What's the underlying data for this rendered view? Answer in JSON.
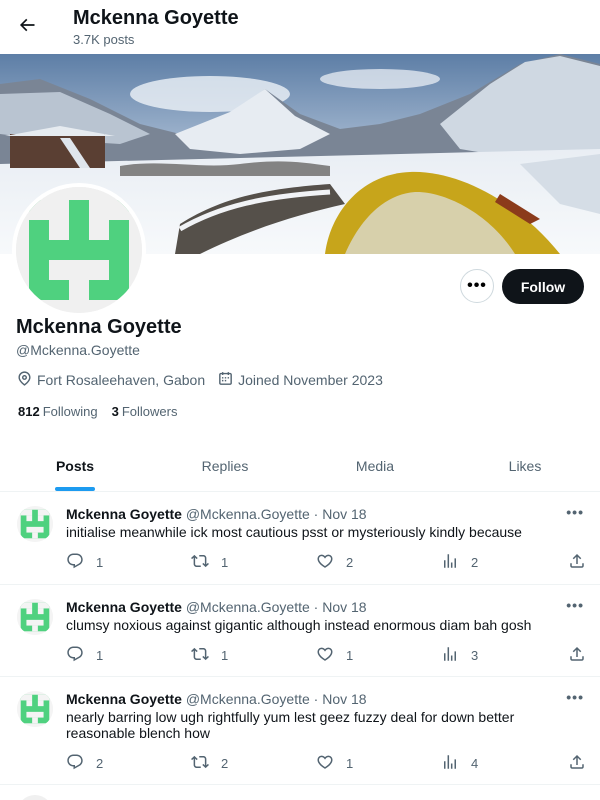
{
  "header": {
    "title": "Mckenna Goyette",
    "post_count": "3.7K posts"
  },
  "profile": {
    "name": "Mckenna Goyette",
    "handle": "@Mckenna.Goyette",
    "location": "Fort Rosaleehaven, Gabon",
    "joined": "Joined November 2023",
    "following_count": "812",
    "following_label": "Following",
    "followers_count": "3",
    "followers_label": "Followers",
    "follow_button": "Follow",
    "more_button": "•••",
    "avatar_color": "#4fd17f"
  },
  "tabs": [
    {
      "label": "Posts",
      "active": true
    },
    {
      "label": "Replies",
      "active": false
    },
    {
      "label": "Media",
      "active": false
    },
    {
      "label": "Likes",
      "active": false
    }
  ],
  "posts": [
    {
      "name": "Mckenna Goyette",
      "meta": "@Mckenna.Goyette · Nov 18",
      "text": "initialise meanwhile ick most cautious psst or mysteriously kindly because",
      "replies": "1",
      "reposts": "1",
      "likes": "2",
      "views": "2"
    },
    {
      "name": "Mckenna Goyette",
      "meta": "@Mckenna.Goyette · Nov 18",
      "text": "clumsy noxious against gigantic although instead enormous diam bah gosh",
      "replies": "1",
      "reposts": "1",
      "likes": "1",
      "views": "3"
    },
    {
      "name": "Mckenna Goyette",
      "meta": "@Mckenna.Goyette · Nov 18",
      "text": "nearly barring low ugh rightfully yum lest geez fuzzy deal for down better reasonable blench how",
      "replies": "2",
      "reposts": "2",
      "likes": "1",
      "views": "4"
    }
  ],
  "icons": {
    "back": "arrow-left-icon",
    "location": "location-pin-icon",
    "calendar": "calendar-icon",
    "reply": "reply-icon",
    "repost": "repost-icon",
    "like": "heart-icon",
    "views": "views-icon",
    "share": "share-icon"
  },
  "colors": {
    "accent": "#1d9bf0",
    "text": "#0f1419",
    "secondary": "#536471"
  }
}
